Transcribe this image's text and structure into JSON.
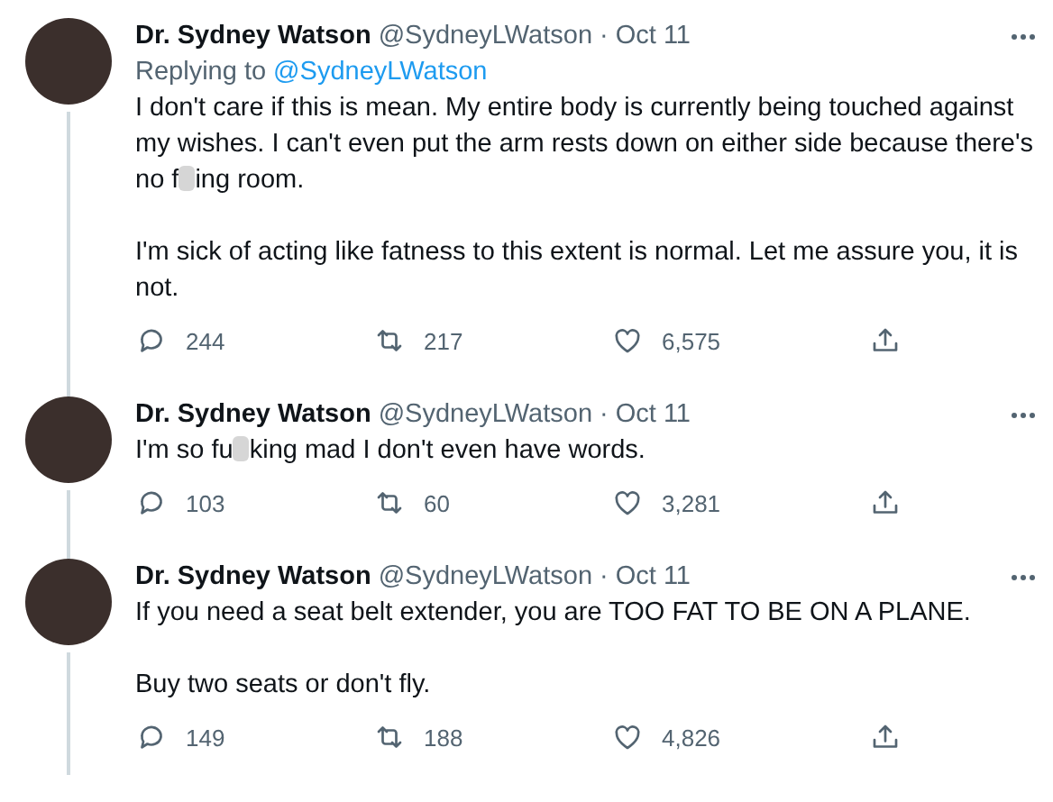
{
  "tweets": [
    {
      "name": "Dr. Sydney Watson",
      "handle": "@SydneyLWatson",
      "separator": "·",
      "date": "Oct 11",
      "replying_to": {
        "label": "Replying to",
        "handle": "@SydneyLWatson"
      },
      "paragraphs": [
        [
          "I don't care if this is mean. My entire body is currently being touched against my wishes. I can't even put the arm rests down on either side because there's no f",
          "ing room."
        ],
        [
          "I'm sick of acting like fatness to this extent is normal. Let me assure you, it is not."
        ]
      ],
      "replies": "244",
      "retweets": "217",
      "likes": "6,575"
    },
    {
      "name": "Dr. Sydney Watson",
      "handle": "@SydneyLWatson",
      "separator": "·",
      "date": "Oct 11",
      "paragraphs": [
        [
          "I'm so fu",
          "king mad I don't even have words."
        ]
      ],
      "replies": "103",
      "retweets": "60",
      "likes": "3,281"
    },
    {
      "name": "Dr. Sydney Watson",
      "handle": "@SydneyLWatson",
      "separator": "·",
      "date": "Oct 11",
      "paragraphs": [
        [
          "If you need a seat belt extender, you are TOO FAT TO BE ON A PLANE."
        ],
        [
          "Buy two seats or don't fly."
        ]
      ],
      "replies": "149",
      "retweets": "188",
      "likes": "4,826"
    }
  ]
}
